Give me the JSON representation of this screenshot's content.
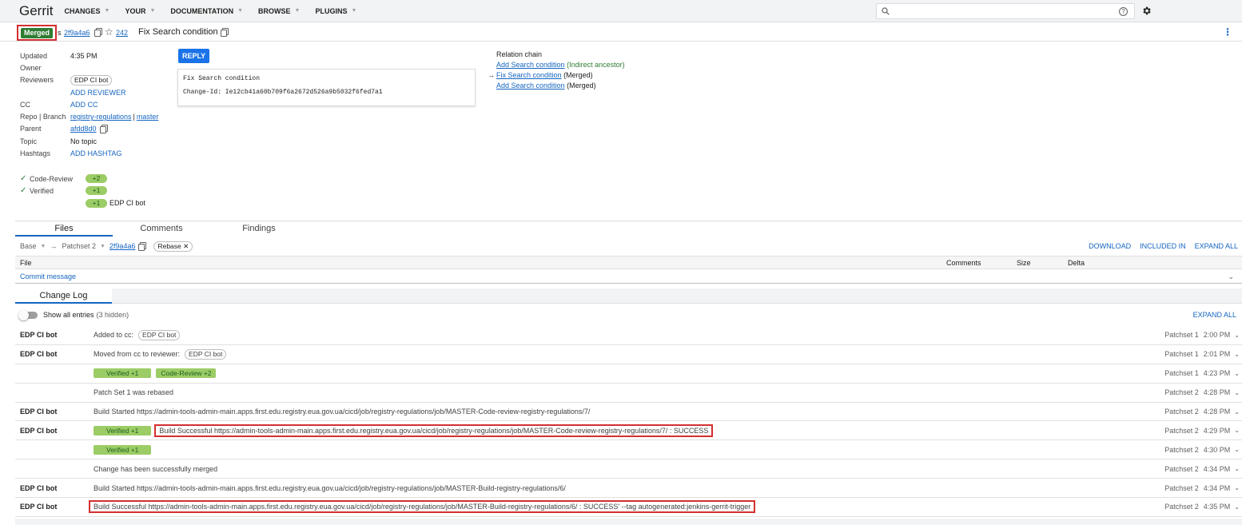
{
  "header": {
    "logo": "Gerrit",
    "nav": [
      "CHANGES",
      "YOUR",
      "DOCUMENTATION",
      "BROWSE",
      "PLUGINS"
    ],
    "search_placeholder": "",
    "help_glyph": "?"
  },
  "change": {
    "status": "Merged",
    "as_fragment": "s",
    "commit": "2f9a4a6",
    "number": "242",
    "subject": "Fix Search condition"
  },
  "meta": {
    "updated_key": "Updated",
    "updated_val": "4:35 PM",
    "owner_key": "Owner",
    "reviewers_key": "Reviewers",
    "reviewer_chip": "EDP CI bot",
    "add_reviewer": "ADD REVIEWER",
    "cc_key": "CC",
    "add_cc": "ADD CC",
    "repo_key": "Repo | Branch",
    "repo": "registry-regulations",
    "sep": "|",
    "branch": "master",
    "parent_key": "Parent",
    "parent": "afdd8d0",
    "topic_key": "Topic",
    "topic": "No topic",
    "hashtags_key": "Hashtags",
    "add_hashtag": "ADD HASHTAG"
  },
  "labels": {
    "code_review": "Code-Review",
    "code_review_vote": "+2",
    "verified": "Verified",
    "verified_vote": "+1",
    "extra_vote": "+1",
    "extra_voter": "EDP CI bot"
  },
  "reply": "REPLY",
  "commit_message": {
    "line1": "Fix Search condition",
    "line2": "Change-Id: Ie12cb41a60b709f6a2672d526a9b5032f6fed7a1"
  },
  "relation": {
    "title": "Relation chain",
    "items": [
      {
        "link": "Add Search condition",
        "note": "(Indirect ancestor)",
        "note_color": "#2e7d32"
      },
      {
        "link": "Fix Search condition",
        "note": "(Merged)",
        "note_color": "#424242"
      },
      {
        "link": "Add Search condition",
        "note": "(Merged)",
        "note_color": "#424242"
      }
    ],
    "arrow": "→"
  },
  "tabs": [
    "Files",
    "Comments",
    "Findings"
  ],
  "files_bar": {
    "base": "Base",
    "arrow": "→",
    "patchset": "Patchset 2",
    "commit": "2f9a4a6",
    "rebase_chip": "Rebase ✕",
    "download": "DOWNLOAD",
    "included_in": "INCLUDED IN",
    "expand_all": "EXPAND ALL"
  },
  "file_table": {
    "col_file": "File",
    "col_comments": "Comments",
    "col_size": "Size",
    "col_delta": "Delta",
    "commit_message": "Commit message"
  },
  "change_log": {
    "tab": "Change Log",
    "toggle_label": "Show all entries",
    "hidden": "(3 hidden)",
    "expand_all": "EXPAND ALL",
    "rows": [
      {
        "author": "EDP CI bot",
        "msg": "Added to cc:",
        "chip": "EDP CI bot",
        "ps": "Patchset 1",
        "time": "2:00 PM"
      },
      {
        "author": "EDP CI bot",
        "msg": "Moved from cc to reviewer:",
        "chip": "EDP CI bot",
        "ps": "Patchset 1",
        "time": "2:01 PM"
      },
      {
        "author": "",
        "v1": "Verified +1",
        "v2": "Code-Review +2",
        "ps": "Patchset 1",
        "time": "4:23 PM"
      },
      {
        "author": "",
        "msg": "Patch Set 1 was rebased",
        "ps": "Patchset 2",
        "time": "4:28 PM"
      },
      {
        "author": "EDP CI bot",
        "msg": "Build Started https://admin-tools-admin-main.apps.first.edu.registry.eua.gov.ua/cicd/job/registry-regulations/job/MASTER-Code-review-registry-regulations/7/",
        "ps": "Patchset 2",
        "time": "4:28 PM"
      },
      {
        "author": "EDP CI bot",
        "v1": "Verified +1",
        "msg": "Build Successful https://admin-tools-admin-main.apps.first.edu.registry.eua.gov.ua/cicd/job/registry-regulations/job/MASTER-Code-review-registry-regulations/7/ : SUCCESS",
        "ps": "Patchset 2",
        "time": "4:29 PM"
      },
      {
        "author": "",
        "v1": "Verified +1",
        "ps": "Patchset 2",
        "time": "4:30 PM"
      },
      {
        "author": "",
        "msg": "Change has been successfully merged",
        "ps": "Patchset 2",
        "time": "4:34 PM"
      },
      {
        "author": "EDP CI bot",
        "msg": "Build Started https://admin-tools-admin-main.apps.first.edu.registry.eua.gov.ua/cicd/job/registry-regulations/job/MASTER-Build-registry-regulations/6/",
        "ps": "Patchset 2",
        "time": "4:34 PM"
      },
      {
        "author": "EDP CI bot",
        "msg": "Build Successful https://admin-tools-admin-main.apps.first.edu.registry.eua.gov.ua/cicd/job/registry-regulations/job/MASTER-Build-registry-regulations/6/ : SUCCESS' --tag autogenerated:jenkins-gerrit-trigger",
        "ps": "Patchset 2",
        "time": "4:35 PM"
      }
    ]
  },
  "colors": {
    "accent": "#1565c0",
    "merged": "#2e7d32",
    "vote": "#9ccc65",
    "highlight": "#d32f2f"
  }
}
